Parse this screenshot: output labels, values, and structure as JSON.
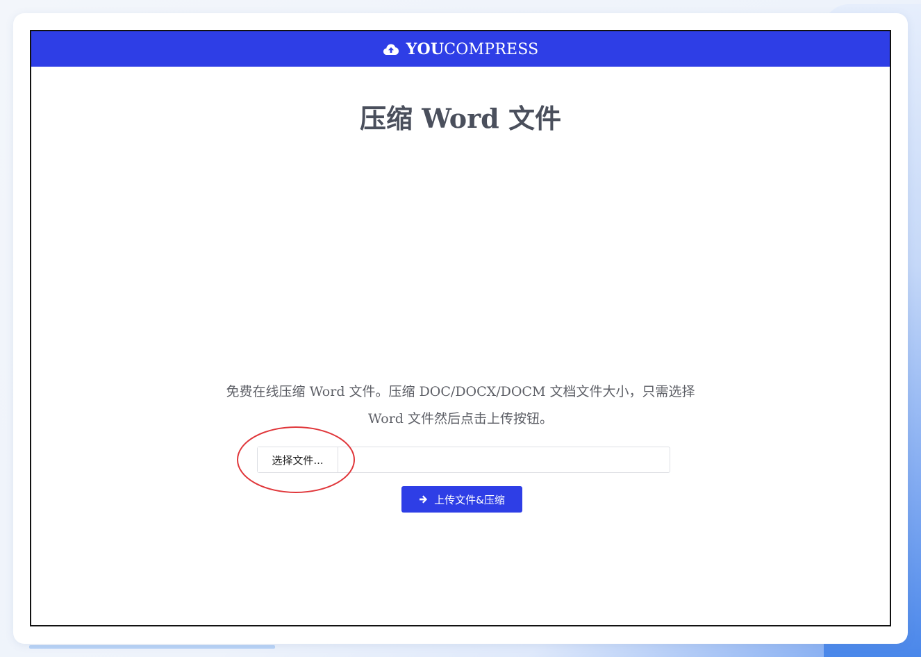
{
  "header": {
    "brand_bold": "YOU",
    "brand_rest": "COMPRESS",
    "brand_icon": "cloud-upload-icon"
  },
  "main": {
    "title": "压缩 Word 文件",
    "description": "免费在线压缩 Word 文件。压缩 DOC/DOCX/DOCM 文档文件大小，只需选择 Word 文件然后点击上传按钮。",
    "file_input": {
      "button_label": "选择文件...",
      "file_name": ""
    },
    "submit": {
      "label": "上传文件&压缩",
      "icon": "arrow-right-icon"
    }
  },
  "colors": {
    "accent": "#2e3ee6",
    "title": "#4a4f5c",
    "annotation_circle": "#e0363a"
  }
}
